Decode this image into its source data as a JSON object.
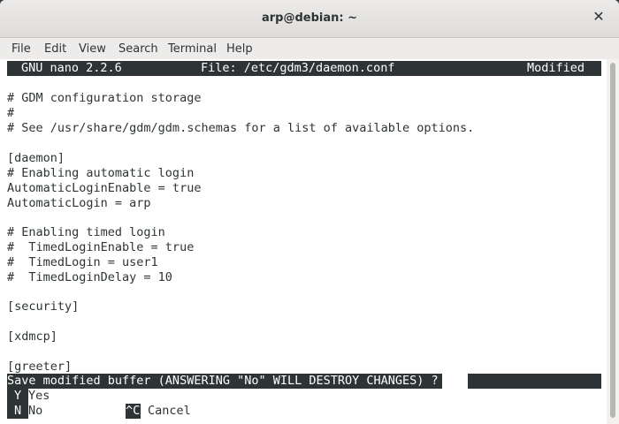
{
  "window": {
    "title": "arp@debian: ~",
    "close_glyph": "✕"
  },
  "menu": [
    "File",
    "Edit",
    "View",
    "Search",
    "Terminal",
    "Help"
  ],
  "nano": {
    "version": "GNU nano 2.2.6",
    "file": "File: /etc/gdm3/daemon.conf",
    "status": "Modified"
  },
  "lines": [
    "# GDM configuration storage",
    "#",
    "# See /usr/share/gdm/gdm.schemas for a list of available options.",
    "",
    "[daemon]",
    "# Enabling automatic login",
    "AutomaticLoginEnable = true",
    "AutomaticLogin = arp",
    "",
    "# Enabling timed login",
    "#  TimedLoginEnable = true",
    "#  TimedLogin = user1",
    "#  TimedLoginDelay = 10",
    "",
    "[security]",
    "",
    "[xdmcp]",
    "",
    "[greeter]"
  ],
  "prompt": "Save modified buffer (ANSWERING \"No\" WILL DESTROY CHANGES) ?",
  "options": [
    {
      "key": "Y",
      "label": "Yes"
    },
    {
      "key": "N",
      "label": "No"
    },
    {
      "key": "^C",
      "label": "Cancel"
    }
  ]
}
